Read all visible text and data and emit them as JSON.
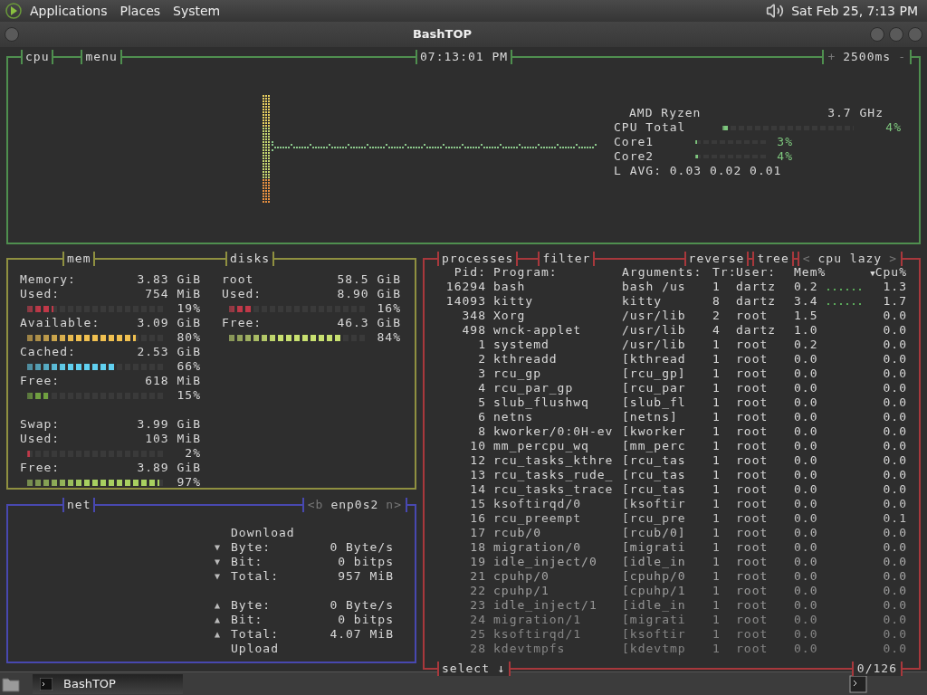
{
  "top_panel": {
    "menus": [
      "Applications",
      "Places",
      "System"
    ],
    "clock": "Sat Feb 25, 7:13 PM"
  },
  "window": {
    "title": "BashTOP"
  },
  "cpu": {
    "title": "cpu",
    "menu": "menu",
    "clock": "07:13:01 PM",
    "plus": "+",
    "interval": "2500ms",
    "minus": "-",
    "model": "AMD Ryzen",
    "freq": "3.7 GHz",
    "total": {
      "label": "CPU Total",
      "level": 0.04,
      "percent": "4%"
    },
    "cores": [
      {
        "label": "Core1",
        "level": 0.03,
        "percent": "3%"
      },
      {
        "label": "Core2",
        "level": 0.04,
        "percent": "4%"
      }
    ],
    "load": "L AVG: 0.03 0.02 0.01"
  },
  "mem": {
    "title": "mem",
    "items": [
      {
        "kind": "total",
        "label": "Memory:",
        "value": "3.83 GiB"
      },
      {
        "kind": "meter",
        "label": "Used:",
        "value": "754 MiB",
        "level": 0.19,
        "percent": "19%",
        "color": "#c03848"
      },
      {
        "kind": "meter",
        "label": "Available:",
        "value": "3.09 GiB",
        "level": 0.8,
        "percent": "80%",
        "color": "#f0c050"
      },
      {
        "kind": "meter",
        "label": "Cached:",
        "value": "2.53 GiB",
        "level": 0.66,
        "percent": "66%",
        "color": "#60d0f0"
      },
      {
        "kind": "meter",
        "label": "Free:",
        "value": "618 MiB",
        "level": 0.15,
        "percent": "15%",
        "color": "#70a040"
      },
      {
        "kind": "total",
        "label": "Swap:",
        "value": "3.99 GiB"
      },
      {
        "kind": "meter",
        "label": "Used:",
        "value": "103 MiB",
        "level": 0.02,
        "percent": "2%",
        "color": "#c03848"
      },
      {
        "kind": "meter",
        "label": "Free:",
        "value": "3.89 GiB",
        "level": 0.97,
        "percent": "97%",
        "color": "#a8d060"
      }
    ]
  },
  "disks": {
    "title": "disks",
    "items": [
      {
        "kind": "total",
        "label": "root",
        "value": "58.5 GiB"
      },
      {
        "kind": "meter",
        "label": "Used:",
        "value": "8.90 GiB",
        "level": 0.16,
        "percent": "16%",
        "color": "#c03848"
      },
      {
        "kind": "meter",
        "label": "Free:",
        "value": "46.3 GiB",
        "level": 0.84,
        "percent": "84%",
        "color": "#c8e070"
      }
    ]
  },
  "net": {
    "title": "net",
    "iface_prev": "<b",
    "iface": "enp0s2",
    "iface_next": "n>",
    "download_label": "Download",
    "download": [
      {
        "arrow": "▼",
        "label": "Byte:",
        "value": "0 Byte/s"
      },
      {
        "arrow": "▼",
        "label": "Bit:",
        "value": "0 bitps"
      },
      {
        "arrow": "▼",
        "label": "Total:",
        "value": "957 MiB"
      }
    ],
    "upload": [
      {
        "arrow": "▲",
        "label": "Byte:",
        "value": "0 Byte/s"
      },
      {
        "arrow": "▲",
        "label": "Bit:",
        "value": "0 bitps"
      },
      {
        "arrow": "▲",
        "label": "Total:",
        "value": "4.07 MiB"
      }
    ],
    "upload_label": "Upload"
  },
  "processes": {
    "title": "processes",
    "filter": "filter",
    "reverse": "reverse",
    "tree": "tree",
    "sort_prev": "<",
    "sort": "cpu lazy",
    "sort_next": ">",
    "columns": [
      "Pid:",
      "Program:",
      "Arguments:",
      "Tr:",
      "User:",
      "Mem%",
      "Cpu%"
    ],
    "sort_mark": "▼",
    "rows": [
      {
        "pid": "16294",
        "program": "bash",
        "args": "bash /us",
        "threads": "1",
        "user": "dartz",
        "mem": "0.2",
        "cpu": "1.3",
        "sparkline": true
      },
      {
        "pid": "14093",
        "program": "kitty",
        "args": "kitty",
        "threads": "8",
        "user": "dartz",
        "mem": "3.4",
        "cpu": "1.7",
        "sparkline": true
      },
      {
        "pid": "348",
        "program": "Xorg",
        "args": "/usr/lib",
        "threads": "2",
        "user": "root",
        "mem": "1.5",
        "cpu": "0.0",
        "sparkline": false
      },
      {
        "pid": "498",
        "program": "wnck-applet",
        "args": "/usr/lib",
        "threads": "4",
        "user": "dartz",
        "mem": "1.0",
        "cpu": "0.0",
        "sparkline": false
      },
      {
        "pid": "1",
        "program": "systemd",
        "args": "/usr/lib",
        "threads": "1",
        "user": "root",
        "mem": "0.2",
        "cpu": "0.0",
        "sparkline": false
      },
      {
        "pid": "2",
        "program": "kthreadd",
        "args": "[kthread",
        "threads": "1",
        "user": "root",
        "mem": "0.0",
        "cpu": "0.0",
        "sparkline": false
      },
      {
        "pid": "3",
        "program": "rcu_gp",
        "args": "[rcu_gp]",
        "threads": "1",
        "user": "root",
        "mem": "0.0",
        "cpu": "0.0",
        "sparkline": false
      },
      {
        "pid": "4",
        "program": "rcu_par_gp",
        "args": "[rcu_par",
        "threads": "1",
        "user": "root",
        "mem": "0.0",
        "cpu": "0.0",
        "sparkline": false
      },
      {
        "pid": "5",
        "program": "slub_flushwq",
        "args": "[slub_fl",
        "threads": "1",
        "user": "root",
        "mem": "0.0",
        "cpu": "0.0",
        "sparkline": false
      },
      {
        "pid": "6",
        "program": "netns",
        "args": "[netns]",
        "threads": "1",
        "user": "root",
        "mem": "0.0",
        "cpu": "0.0",
        "sparkline": false
      },
      {
        "pid": "8",
        "program": "kworker/0:0H-ev",
        "args": "[kworker",
        "threads": "1",
        "user": "root",
        "mem": "0.0",
        "cpu": "0.0",
        "sparkline": false
      },
      {
        "pid": "10",
        "program": "mm_percpu_wq",
        "args": "[mm_perc",
        "threads": "1",
        "user": "root",
        "mem": "0.0",
        "cpu": "0.0",
        "sparkline": false
      },
      {
        "pid": "12",
        "program": "rcu_tasks_kthre",
        "args": "[rcu_tas",
        "threads": "1",
        "user": "root",
        "mem": "0.0",
        "cpu": "0.0",
        "sparkline": false
      },
      {
        "pid": "13",
        "program": "rcu_tasks_rude_",
        "args": "[rcu_tas",
        "threads": "1",
        "user": "root",
        "mem": "0.0",
        "cpu": "0.0",
        "sparkline": false
      },
      {
        "pid": "14",
        "program": "rcu_tasks_trace",
        "args": "[rcu_tas",
        "threads": "1",
        "user": "root",
        "mem": "0.0",
        "cpu": "0.0",
        "sparkline": false
      },
      {
        "pid": "15",
        "program": "ksoftirqd/0",
        "args": "[ksoftir",
        "threads": "1",
        "user": "root",
        "mem": "0.0",
        "cpu": "0.0",
        "sparkline": false
      },
      {
        "pid": "16",
        "program": "rcu_preempt",
        "args": "[rcu_pre",
        "threads": "1",
        "user": "root",
        "mem": "0.0",
        "cpu": "0.1",
        "sparkline": false
      },
      {
        "pid": "17",
        "program": "rcub/0",
        "args": "[rcub/0]",
        "threads": "1",
        "user": "root",
        "mem": "0.0",
        "cpu": "0.0",
        "sparkline": false
      },
      {
        "pid": "18",
        "program": "migration/0",
        "args": "[migrati",
        "threads": "1",
        "user": "root",
        "mem": "0.0",
        "cpu": "0.0",
        "sparkline": false
      },
      {
        "pid": "19",
        "program": "idle_inject/0",
        "args": "[idle_in",
        "threads": "1",
        "user": "root",
        "mem": "0.0",
        "cpu": "0.0",
        "sparkline": false
      },
      {
        "pid": "21",
        "program": "cpuhp/0",
        "args": "[cpuhp/0",
        "threads": "1",
        "user": "root",
        "mem": "0.0",
        "cpu": "0.0",
        "sparkline": false
      },
      {
        "pid": "22",
        "program": "cpuhp/1",
        "args": "[cpuhp/1",
        "threads": "1",
        "user": "root",
        "mem": "0.0",
        "cpu": "0.0",
        "sparkline": false
      },
      {
        "pid": "23",
        "program": "idle_inject/1",
        "args": "[idle_in",
        "threads": "1",
        "user": "root",
        "mem": "0.0",
        "cpu": "0.0",
        "sparkline": false
      },
      {
        "pid": "24",
        "program": "migration/1",
        "args": "[migrati",
        "threads": "1",
        "user": "root",
        "mem": "0.0",
        "cpu": "0.0",
        "sparkline": false
      },
      {
        "pid": "25",
        "program": "ksoftirqd/1",
        "args": "[ksoftir",
        "threads": "1",
        "user": "root",
        "mem": "0.0",
        "cpu": "0.0",
        "sparkline": false
      },
      {
        "pid": "28",
        "program": "kdevtmpfs",
        "args": "[kdevtmp",
        "threads": "1",
        "user": "root",
        "mem": "0.0",
        "cpu": "0.0",
        "sparkline": false
      }
    ],
    "select": "select ↓",
    "count": "0/126"
  },
  "taskbar": {
    "task": "BashTOP"
  }
}
